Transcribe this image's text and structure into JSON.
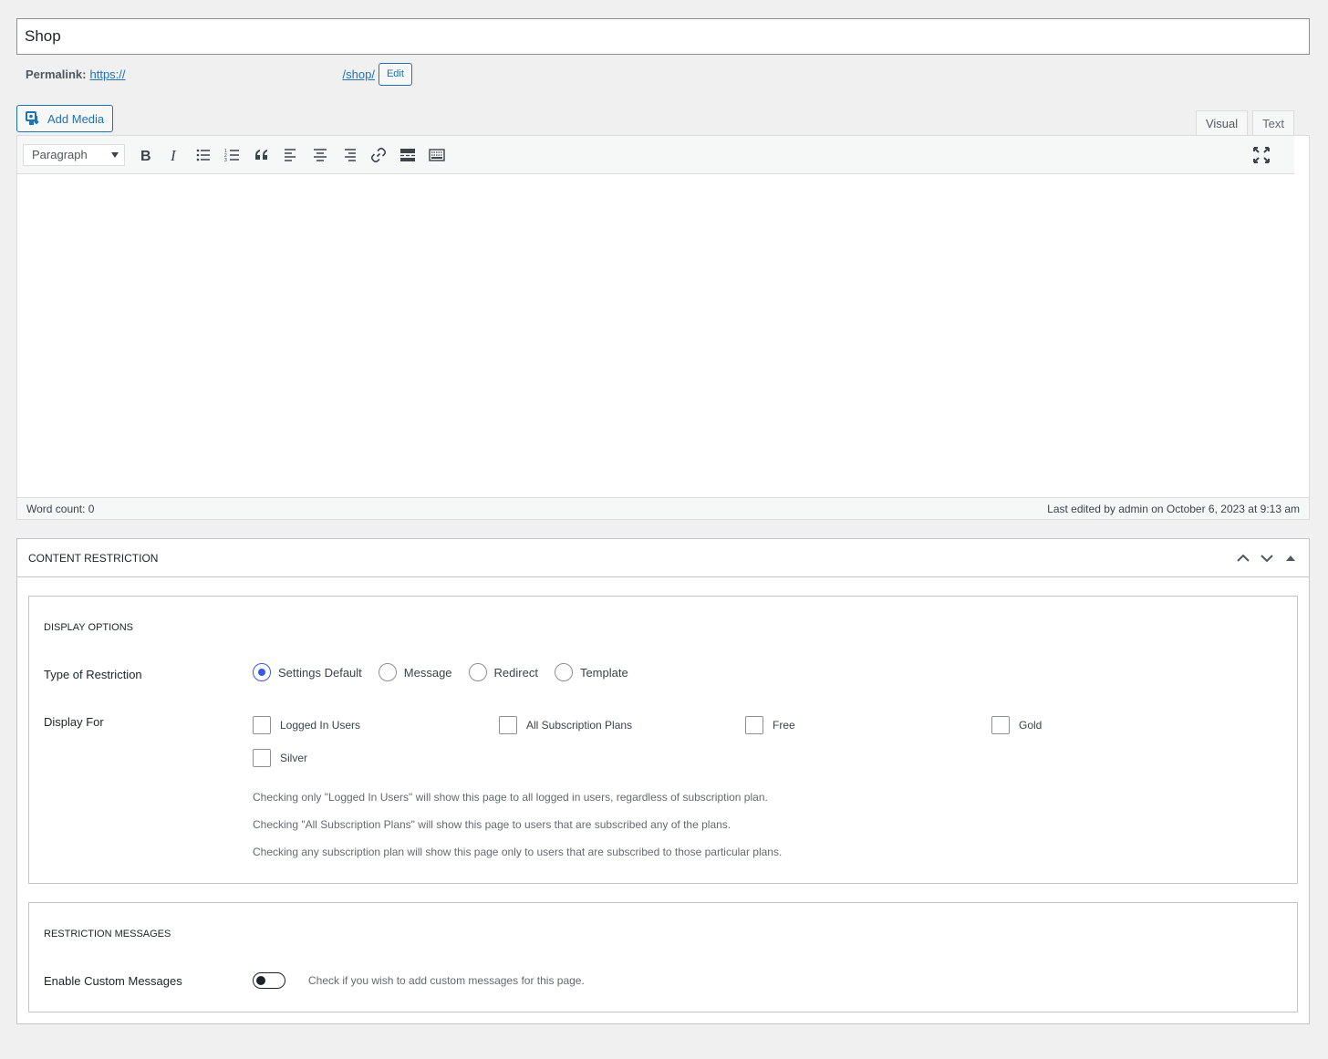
{
  "title": {
    "value": "Shop"
  },
  "permalink": {
    "label": "Permalink:",
    "url_prefix": "https://",
    "url_suffix": "/shop/",
    "edit_label": "Edit"
  },
  "media": {
    "add_label": "Add Media"
  },
  "editor_tabs": [
    {
      "label": "Visual",
      "active": true
    },
    {
      "label": "Text",
      "active": false
    }
  ],
  "toolbar": {
    "format_select": "Paragraph",
    "buttons": [
      "bold-icon",
      "italic-icon",
      "bulleted-list-icon",
      "numbered-list-icon",
      "blockquote-icon",
      "align-left-icon",
      "align-center-icon",
      "align-right-icon",
      "link-icon",
      "read-more-icon",
      "toolbar-toggle-icon"
    ],
    "fullscreen_icon": "fullscreen-icon"
  },
  "status_bar": {
    "word_count": "Word count: 0",
    "last_edited": "Last edited by admin on October 6, 2023 at 9:13 am"
  },
  "content_restriction": {
    "title": "CONTENT RESTRICTION",
    "display_options": {
      "title": "DISPLAY OPTIONS",
      "type_label": "Type of Restriction",
      "types": [
        {
          "label": "Settings Default",
          "checked": true
        },
        {
          "label": "Message",
          "checked": false
        },
        {
          "label": "Redirect",
          "checked": false
        },
        {
          "label": "Template",
          "checked": false
        }
      ],
      "display_for_label": "Display For",
      "display_for": [
        {
          "label": "Logged In Users",
          "checked": false
        },
        {
          "label": "All Subscription Plans",
          "checked": false
        },
        {
          "label": "Free",
          "checked": false
        },
        {
          "label": "Gold",
          "checked": false
        },
        {
          "label": "Silver",
          "checked": false
        }
      ],
      "help": [
        "Checking only \"Logged In Users\" will show this page to all logged in users, regardless of subscription plan.",
        "Checking \"All Subscription Plans\" will show this page to users that are subscribed any of the plans.",
        "Checking any subscription plan will show this page only to users that are subscribed to those particular plans."
      ]
    },
    "restriction_messages": {
      "title": "RESTRICTION MESSAGES",
      "enable_label": "Enable Custom Messages",
      "enable_on": false,
      "enable_help": "Check if you wish to add custom messages for this page."
    }
  },
  "colors": {
    "accent": "#2271b1",
    "radio": "#3858e9"
  }
}
